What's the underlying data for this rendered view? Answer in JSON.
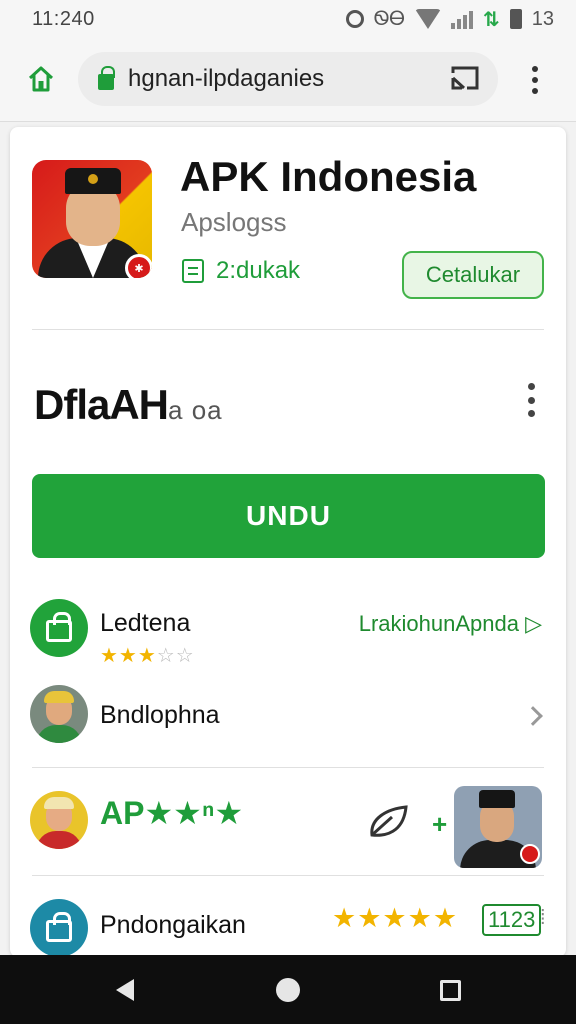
{
  "status_bar": {
    "time": "11:240",
    "carrier_text": "ᏫᎾ",
    "data_arrows": "⇅",
    "battery_level": "13"
  },
  "browser": {
    "url": "hgnan-ilpdaganies"
  },
  "app": {
    "title": "APK Indonesia",
    "subtitle": "Apslogss",
    "size": "2:dukak",
    "catalog_button": "Cetalukar"
  },
  "section": {
    "title_main": "DflaAH",
    "title_small": "a oa"
  },
  "download_button": "UNDU",
  "list": [
    {
      "label": "Ledtena",
      "rating": 3,
      "rating_max": 5,
      "link": "LrakiohunApnda ▷"
    },
    {
      "label": "Bndlophna"
    },
    {
      "label": "AP",
      "stars_text": "★★ⁿ★"
    },
    {
      "label": "Pndongaikan",
      "rating": 5,
      "count": "1123",
      "extra": "⁞"
    }
  ],
  "colors": {
    "accent_green": "#21a33a",
    "star_yellow": "#f2b400",
    "icon_red": "#d61a1a"
  }
}
